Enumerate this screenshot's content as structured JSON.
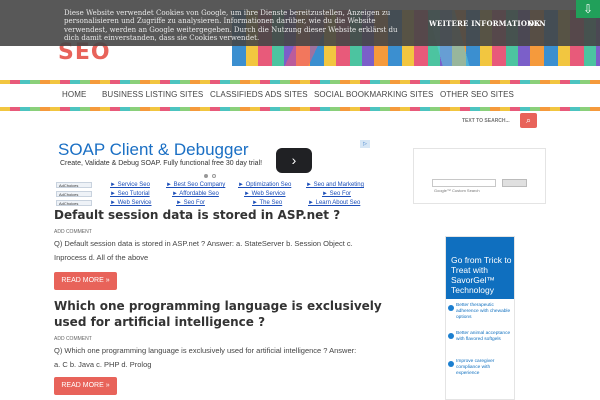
{
  "cookie": {
    "text": "Diese Website verwendet Cookies von Google, um ihre Dienste bereitzustellen, Anzeigen zu personalisieren und Zugriffe zu analysieren. Informationen darüber, wie du die Website verwendest, werden an Google weitergegeben. Durch die Nutzung dieser Website erklärst du dich damit einverstanden, dass sie Cookies verwendet.",
    "more_label": "WEITERE INFORMATIONEN",
    "ok_label": "OK"
  },
  "header": {
    "logo_text": "SEO"
  },
  "nav": {
    "items": [
      "HOME",
      "BUSINESS LISTING SITES",
      "CLASSIFIEDS ADS SITES",
      "SOCIAL BOOKMARKING SITES",
      "OTHER SEO SITES"
    ]
  },
  "search": {
    "placeholder": "TEXT TO SEARCH..."
  },
  "ad": {
    "title": "SOAP Client & Debugger",
    "subtitle": "Create, Validate & Debug SOAP. Fully functional free 30 day trial!"
  },
  "link_units": {
    "adchoices_label": "AdChoices",
    "rows": [
      [
        "► Service Seo",
        "► Best Seo Company",
        "► Optimization Seo",
        "► Seo and Marketing"
      ],
      [
        "► Seo Tutorial",
        "► Affordable Seo",
        "► Web Service",
        "► Seo For"
      ],
      [
        "► Web Service",
        "► Seo For",
        "► The Seo",
        "► Learn About Seo"
      ]
    ]
  },
  "posts": [
    {
      "title": "Default session data is stored in ASP.net ?",
      "comment": "ADD COMMENT",
      "excerpt": "Q) Default session data is stored in ASP.net ? Answer: a. StateServer b. Session Object c. Inprocess d. All of the above",
      "read_more": "READ MORE »"
    },
    {
      "title": "Which one programming language is exclusively used for artificial intelligence ?",
      "comment": "ADD COMMENT",
      "excerpt": "Q) Which one programming language is exclusively used for artificial intelligence ? Answer: a. C b. Java c. PHP d. Prolog",
      "read_more": "READ MORE »"
    }
  ],
  "sidebar": {
    "cse_label": "Google™ Custom Search",
    "ad_title": "Go from Trick to Treat with SavorGel™ Technology",
    "ad_points": [
      "Better therapeutic adherence with chewable options",
      "Better animal acceptance with flavored softgels",
      "Improve caregiver compliance with experience"
    ]
  },
  "colors": {
    "accent": "#e8635a",
    "link": "#1a4db8",
    "ad_blue": "#0f6fbf"
  }
}
